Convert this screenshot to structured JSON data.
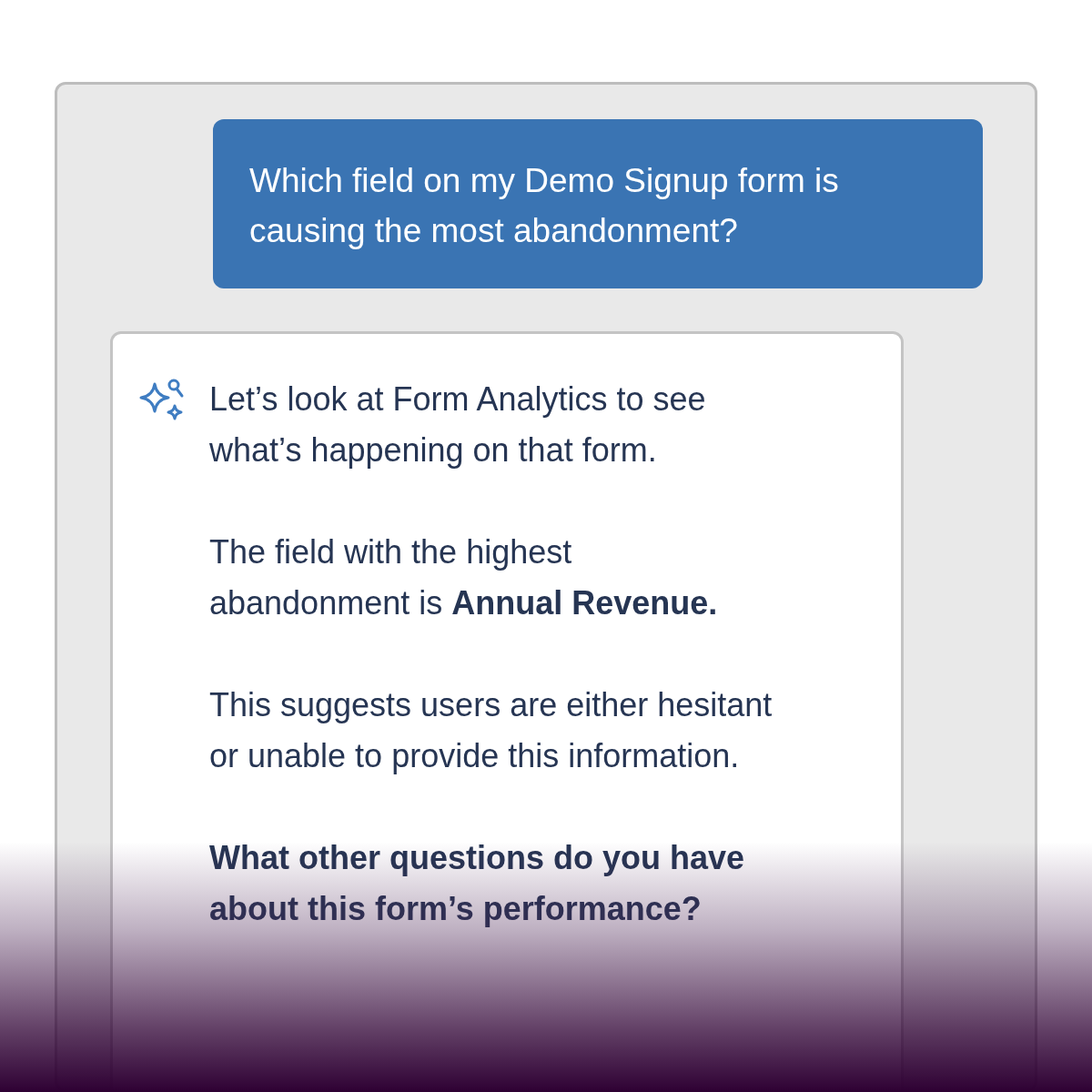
{
  "user_message": {
    "text": "Which field on my Demo Signup form is causing the most abandonment?"
  },
  "assistant_message": {
    "paragraphs": [
      {
        "text": "Let’s look at Form Analytics to see what’s happening on that form.",
        "bold": false
      },
      {
        "text": "The field with the highest abandonment is **Annual Revenue.**",
        "bold": false
      },
      {
        "text": "This suggests users are either hesitant or unable to provide this information.",
        "bold": false
      },
      {
        "text": "What other questions do you have about this form’s performance?",
        "bold": true
      }
    ]
  }
}
